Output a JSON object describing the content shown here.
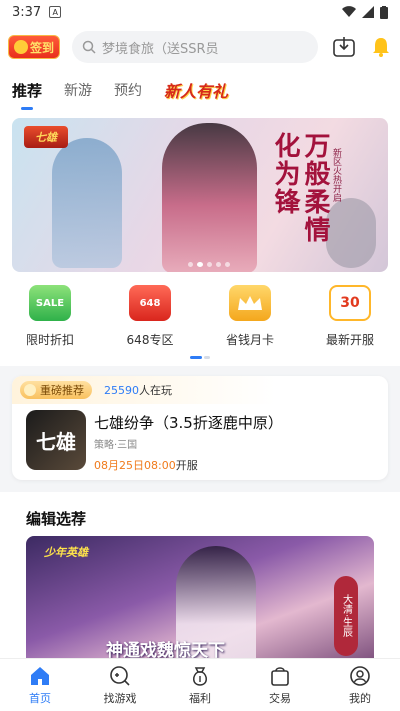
{
  "status_bar": {
    "time": "3:37",
    "notif_badge": "A"
  },
  "header": {
    "sign_in_label": "签到",
    "search_placeholder": "梦境食旅（送SSR员"
  },
  "tabs": [
    {
      "label": "推荐",
      "active": true
    },
    {
      "label": "新游",
      "active": false
    },
    {
      "label": "预约",
      "active": false
    },
    {
      "label": "新人有礼",
      "active": false
    }
  ],
  "banner": {
    "logo_text": "七雄",
    "slogan": "万般柔情化为锋",
    "side_text": "新区火热开启",
    "slides": 5,
    "current_slide": 1
  },
  "quick_entries": [
    {
      "icon": "sale-tag-icon",
      "icon_text": "SALE",
      "label": "限时折扣"
    },
    {
      "icon": "648-zone-icon",
      "icon_text": "648",
      "label": "648专区"
    },
    {
      "icon": "crown-card-icon",
      "icon_text": "",
      "label": "省钱月卡"
    },
    {
      "icon": "calendar-icon",
      "icon_text": "30",
      "label": "最新开服"
    }
  ],
  "featured": {
    "tag": "重磅推荐",
    "online_count": "25590",
    "online_suffix": "人在玩",
    "thumb_text": "七雄",
    "game_name": "七雄纷争（3.5折逐鹿中原）",
    "category": "策略·三国",
    "open_time": "08月25日08:00",
    "open_suffix": "开服"
  },
  "editor_pick": {
    "title": "编辑选荐",
    "poster_logo": "少年英雄",
    "poster_text": "神通戏魏惊天下",
    "poster_side": "大清·生辰"
  },
  "bottom_nav": [
    {
      "label": "首页",
      "icon": "home-icon",
      "active": true
    },
    {
      "label": "找游戏",
      "icon": "find-game-icon",
      "active": false
    },
    {
      "label": "福利",
      "icon": "welfare-bag-icon",
      "active": false
    },
    {
      "label": "交易",
      "icon": "trade-bag-icon",
      "active": false
    },
    {
      "label": "我的",
      "icon": "profile-icon",
      "active": false
    }
  ],
  "colors": {
    "accent": "#2e7cf6",
    "highlight": "#f07b1d",
    "sign_in": "#e92f1c"
  }
}
